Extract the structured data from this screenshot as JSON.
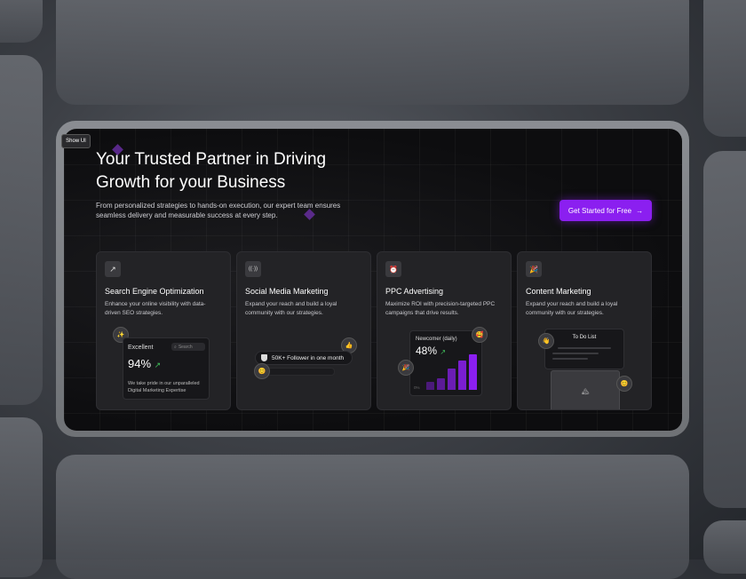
{
  "show_ui_label": "Show UI",
  "hero": {
    "title": "Your Trusted Partner in Driving Growth for your Business",
    "subtitle": "From personalized strategies to hands-on execution, our expert team ensures seamless delivery and measurable success at every step.",
    "cta_label": "Get Started for Free",
    "cta_arrow": "→"
  },
  "colors": {
    "accent": "#8b1ff0",
    "card_bg": "#232326",
    "panel_bg": "#0d0d0f",
    "growth_green": "#3fbf5a"
  },
  "cards": [
    {
      "icon": "trend-up-icon",
      "icon_glyph": "↗",
      "title": "Search Engine Optimization",
      "desc": "Enhance your online visibility with data-driven SEO strategies.",
      "preview": {
        "label": "Excellent",
        "value": "94%",
        "search_placeholder": "Search",
        "footnote": "We take pride in our unparalleled Digital Marketing Expertise",
        "badge_glyph": "✨"
      }
    },
    {
      "icon": "broadcast-icon",
      "icon_glyph": "((·))",
      "title": "Social Media Marketing",
      "desc": "Expand your reach and build a loyal community with our strategies.",
      "preview": {
        "pill": "50K+ Follower in one month",
        "emoji_top": "👍",
        "emoji_bottom": "😊"
      }
    },
    {
      "icon": "alarm-icon",
      "icon_glyph": "⏰",
      "title": "PPC Advertising",
      "desc": "Maximize ROI with precision-targeted PPC campaigns that drive results.",
      "preview": {
        "label": "Newcomer (daily)",
        "value": "48%",
        "bars": [
          0.2,
          0.3,
          0.55,
          0.75,
          0.92
        ],
        "emoji_top": "🥰",
        "emoji_side": "🎉",
        "axis_mark": "0%"
      }
    },
    {
      "icon": "party-icon",
      "icon_glyph": "🎉",
      "title": "Content Marketing",
      "desc": "Expand your reach and build a loyal community with our strategies.",
      "preview": {
        "label": "To Do List",
        "emoji_side": "👋",
        "emoji_bottom": "😊",
        "image_glyph": "🏔"
      }
    }
  ]
}
